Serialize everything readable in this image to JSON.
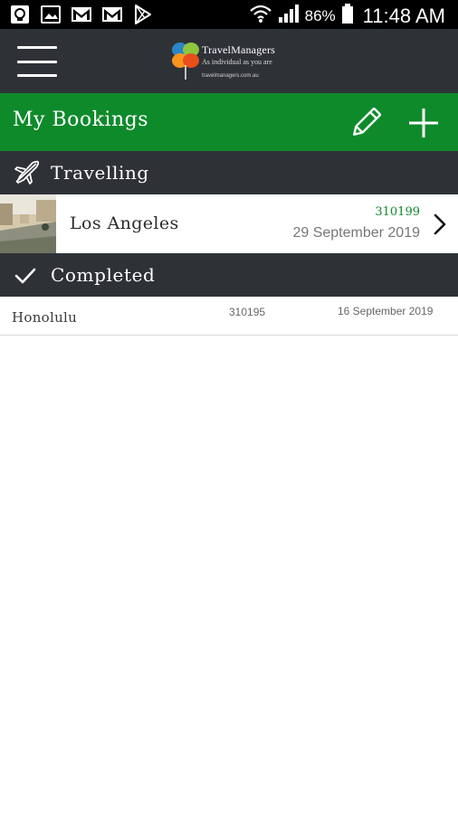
{
  "status_bar": {
    "battery_percent": "86%",
    "time": "11:48 AM",
    "left_icons": [
      "app-icon",
      "photo-icon",
      "gmail-icon",
      "gmail-icon",
      "play-store-icon"
    ],
    "right_icons": [
      "wifi-icon",
      "signal-icon",
      "battery-icon"
    ]
  },
  "header": {
    "logo": {
      "name": "TravelManagers",
      "tagline": "As individual as you are",
      "url": "travelmanagers.com.au"
    }
  },
  "title_bar": {
    "title": "My Bookings",
    "background": "#0e8a2b"
  },
  "sections": {
    "travelling": {
      "label": "Travelling",
      "icon": "airplane-icon",
      "booking": {
        "city": "Los Angeles",
        "reference": "310199",
        "date": "29 September 2019"
      }
    },
    "completed": {
      "label": "Completed",
      "icon": "checkmark-icon",
      "bookings": [
        {
          "city": "Honolulu",
          "reference": "310195",
          "date": "16 September 2019"
        }
      ]
    }
  },
  "colors": {
    "accent_green": "#0e8a2b",
    "dark_bar": "#2e3237"
  }
}
